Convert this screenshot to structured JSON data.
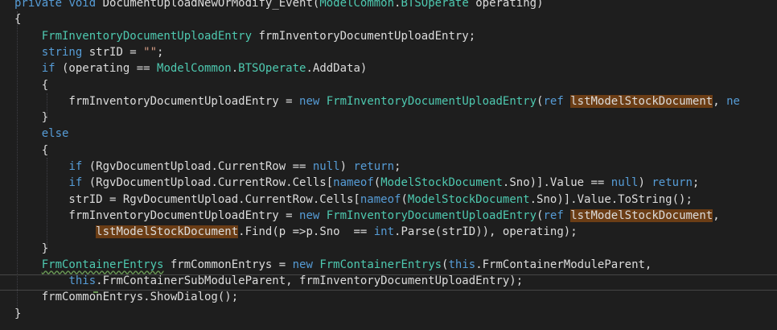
{
  "editor": {
    "theme": {
      "background": "#1e1e1e",
      "keyword": "#569cd6",
      "type": "#4ec9b0",
      "plain": "#dcdcdc",
      "string": "#d69d85",
      "highlight": "#6b3d15",
      "squiggle": "#6a9955"
    },
    "lines": [
      {
        "id": "l0",
        "tokens": [
          [
            "kw",
            "private"
          ],
          [
            "pl",
            " "
          ],
          [
            "kw",
            "void"
          ],
          [
            "pl",
            " DocumentUploadNewOrModify_Event("
          ],
          [
            "ty",
            "ModelCommon"
          ],
          [
            "pl",
            "."
          ],
          [
            "ty",
            "BTSOperate"
          ],
          [
            "pl",
            " operating)"
          ]
        ]
      },
      {
        "id": "l1",
        "tokens": [
          [
            "pl",
            "{"
          ]
        ]
      },
      {
        "id": "l2",
        "tokens": [
          [
            "pl",
            "    "
          ],
          [
            "ty",
            "FrmInventoryDocumentUploadEntry"
          ],
          [
            "pl",
            " frmInventoryDocumentUploadEntry;"
          ]
        ]
      },
      {
        "id": "l3",
        "tokens": [
          [
            "pl",
            "    "
          ],
          [
            "kw",
            "string"
          ],
          [
            "pl",
            " strID = "
          ],
          [
            "st",
            "\"\""
          ],
          [
            "pl",
            ";"
          ]
        ]
      },
      {
        "id": "l4",
        "tokens": [
          [
            "pl",
            "    "
          ],
          [
            "kw",
            "if"
          ],
          [
            "pl",
            " (operating == "
          ],
          [
            "ty",
            "ModelCommon"
          ],
          [
            "pl",
            "."
          ],
          [
            "ty",
            "BTSOperate"
          ],
          [
            "pl",
            ".AddData)"
          ]
        ]
      },
      {
        "id": "l5",
        "tokens": [
          [
            "pl",
            "    {"
          ]
        ]
      },
      {
        "id": "l6",
        "tokens": [
          [
            "pl",
            "        frmInventoryDocumentUploadEntry = "
          ],
          [
            "kw",
            "new"
          ],
          [
            "pl",
            " "
          ],
          [
            "ty",
            "FrmInventoryDocumentUploadEntry"
          ],
          [
            "pl",
            "("
          ],
          [
            "kw",
            "ref"
          ],
          [
            "pl",
            " "
          ],
          [
            "hl",
            "lstModelStockDocument"
          ],
          [
            "pl",
            ", "
          ],
          [
            "kw",
            "ne"
          ]
        ]
      },
      {
        "id": "l7",
        "tokens": [
          [
            "pl",
            "    }"
          ]
        ]
      },
      {
        "id": "l8",
        "tokens": [
          [
            "pl",
            "    "
          ],
          [
            "kw",
            "else"
          ]
        ]
      },
      {
        "id": "l9",
        "tokens": [
          [
            "pl",
            "    {"
          ]
        ]
      },
      {
        "id": "l10",
        "tokens": [
          [
            "pl",
            "        "
          ],
          [
            "kw",
            "if"
          ],
          [
            "pl",
            " (RgvDocumentUpload.CurrentRow == "
          ],
          [
            "kw",
            "null"
          ],
          [
            "pl",
            ") "
          ],
          [
            "kw",
            "return"
          ],
          [
            "pl",
            ";"
          ]
        ]
      },
      {
        "id": "l11",
        "tokens": [
          [
            "pl",
            "        "
          ],
          [
            "kw",
            "if"
          ],
          [
            "pl",
            " (RgvDocumentUpload.CurrentRow.Cells["
          ],
          [
            "kw",
            "nameof"
          ],
          [
            "pl",
            "("
          ],
          [
            "ty",
            "ModelStockDocument"
          ],
          [
            "pl",
            ".Sno)].Value == "
          ],
          [
            "kw",
            "null"
          ],
          [
            "pl",
            ") "
          ],
          [
            "kw",
            "return"
          ],
          [
            "pl",
            ";"
          ]
        ]
      },
      {
        "id": "l12",
        "tokens": [
          [
            "pl",
            "        strID = RgvDocumentUpload.CurrentRow.Cells["
          ],
          [
            "kw",
            "nameof"
          ],
          [
            "pl",
            "("
          ],
          [
            "ty",
            "ModelStockDocument"
          ],
          [
            "pl",
            ".Sno)].Value.ToString();"
          ]
        ]
      },
      {
        "id": "l13",
        "tokens": [
          [
            "pl",
            "        frmInventoryDocumentUploadEntry = "
          ],
          [
            "kw",
            "new"
          ],
          [
            "pl",
            " "
          ],
          [
            "ty",
            "FrmInventoryDocumentUploadEntry"
          ],
          [
            "pl",
            "("
          ],
          [
            "kw",
            "ref"
          ],
          [
            "pl",
            " "
          ],
          [
            "hl",
            "lstModelStockDocument"
          ],
          [
            "pl",
            ","
          ]
        ]
      },
      {
        "id": "l14",
        "tokens": [
          [
            "pl",
            "            "
          ],
          [
            "hl",
            "lstModelStockDocument"
          ],
          [
            "pl",
            ".Find(p =>p.Sno  == "
          ],
          [
            "kw",
            "int"
          ],
          [
            "pl",
            ".Parse(strID)), operating);"
          ]
        ]
      },
      {
        "id": "l15",
        "tokens": [
          [
            "pl",
            "    }"
          ]
        ]
      },
      {
        "id": "l16",
        "tokens": [
          [
            "pl",
            "    "
          ],
          [
            "ty sq",
            "FrmContainerEntrys"
          ],
          [
            "pl",
            " frmCommonEntrys = "
          ],
          [
            "kw",
            "new"
          ],
          [
            "pl",
            " "
          ],
          [
            "ty",
            "FrmContainerEntrys"
          ],
          [
            "pl",
            "("
          ],
          [
            "kw",
            "this"
          ],
          [
            "pl",
            ".FrmContainerModuleParent,"
          ]
        ]
      },
      {
        "id": "l17",
        "tokens": [
          [
            "pl",
            "        "
          ],
          [
            "kw",
            "this"
          ],
          [
            "pl",
            ".FrmContainerSubModuleParent, frmInventoryDocumentUploadEntry);"
          ]
        ]
      },
      {
        "id": "l18",
        "tokens": [
          [
            "pl",
            "    frmCommonEntrys.ShowDialog();"
          ]
        ]
      },
      {
        "id": "l19",
        "tokens": [
          [
            "pl",
            "}"
          ]
        ]
      }
    ]
  }
}
